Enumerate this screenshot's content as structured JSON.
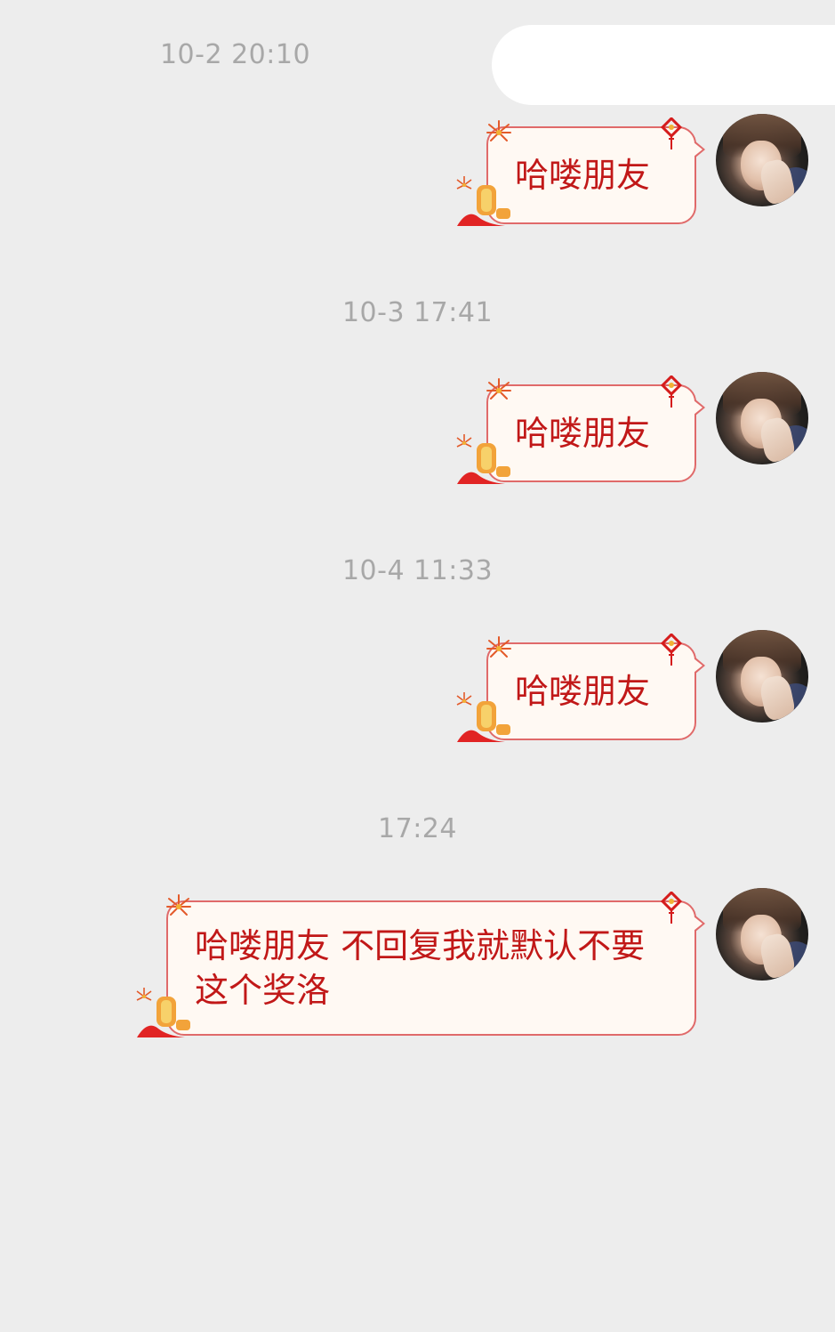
{
  "messages": [
    {
      "time": "10-2 20:10",
      "text": "哈喽朋友"
    },
    {
      "time": "10-3 17:41",
      "text": "哈喽朋友"
    },
    {
      "time": "10-4 11:33",
      "text": "哈喽朋友"
    },
    {
      "time": "17:24",
      "text": "哈喽朋友 不回复我就默认不要这个奖洛"
    }
  ],
  "colors": {
    "background": "#ededed",
    "timestamp": "#a8a8a8",
    "bubble_fill": "#fff9f3",
    "bubble_border": "#e06a6a",
    "bubble_text": "#c11818"
  },
  "icons": {
    "firework": "firework-icon",
    "chinese_knot": "chinese-knot-icon",
    "lantern": "lantern-icon"
  }
}
